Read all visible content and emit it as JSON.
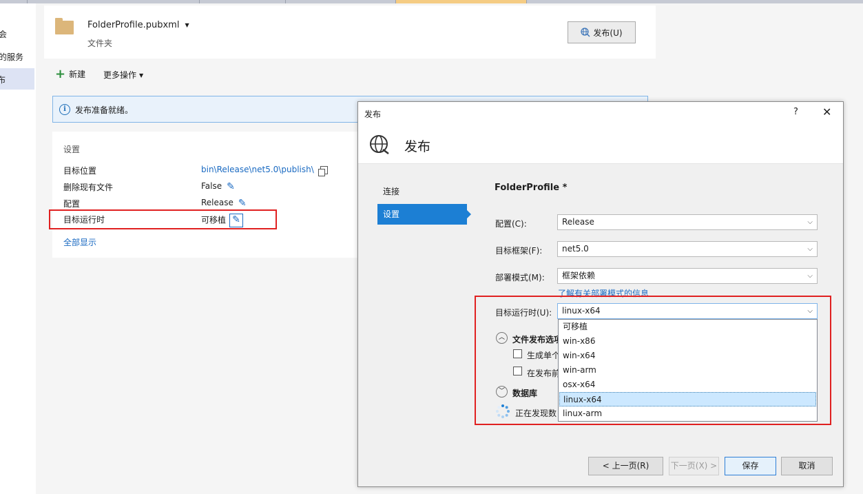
{
  "left_nav": {
    "item1": "会",
    "item2": "的服务",
    "item3": "布"
  },
  "profile": {
    "name": "FolderProfile.pubxml",
    "subtitle": "文件夹",
    "publish_button": "发布(U)"
  },
  "toolbar": {
    "new_label": "新建",
    "more_label": "更多操作"
  },
  "infobar": {
    "text": "发布准备就绪。"
  },
  "settings": {
    "title": "设置",
    "rows": [
      {
        "label": "目标位置",
        "value": "bin\\Release\\net5.0\\publish\\"
      },
      {
        "label": "删除现有文件",
        "value": "False"
      },
      {
        "label": "配置",
        "value": "Release"
      },
      {
        "label": "目标运行时",
        "value": "可移植"
      }
    ],
    "show_all": "全部显示"
  },
  "dialog": {
    "title": "发布",
    "help": "?",
    "close": "✕",
    "header_title": "发布",
    "nav": [
      {
        "label": "连接"
      },
      {
        "label": "设置"
      }
    ],
    "profile_title": "FolderProfile *",
    "fields": {
      "config_label": "配置(C):",
      "config_value": "Release",
      "framework_label": "目标框架(F):",
      "framework_value": "net5.0",
      "deploy_label": "部署模式(M):",
      "deploy_value": "框架依赖",
      "learn_link": "了解有关部署模式的信息",
      "runtime_label": "目标运行时(U):",
      "runtime_value": "linux-x64"
    },
    "runtime_options": [
      "可移植",
      "win-x86",
      "win-x64",
      "win-arm",
      "osx-x64",
      "linux-x64",
      "linux-arm"
    ],
    "selected_runtime_index": 5,
    "sections": {
      "file_publish": "文件发布选项",
      "option1": "生成单个",
      "option2": "在发布前",
      "database": "数据库",
      "discovering": "正在发现数"
    },
    "buttons": {
      "prev": "< 上一页(R)",
      "next": "下一页(X) >",
      "save": "保存",
      "cancel": "取消"
    }
  },
  "colors": {
    "accent": "#1c7fd4",
    "highlight_border": "#e02020",
    "link": "#1a6ac2",
    "selection": "#cce8ff"
  }
}
